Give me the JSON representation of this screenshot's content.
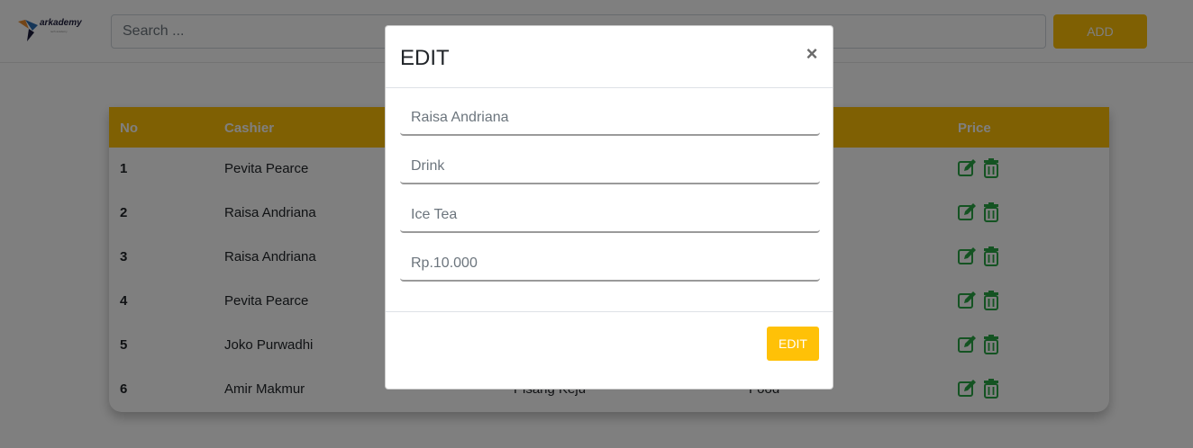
{
  "header": {
    "logo_text": "arkademy",
    "logo_subtext": "tech academy",
    "search_placeholder": "Search ...",
    "add_label": "ADD"
  },
  "table": {
    "headers": {
      "no": "No",
      "cashier": "Cashier",
      "price": "Price"
    },
    "rows": [
      {
        "no": "1",
        "cashier": "Pevita Pearce",
        "product": "",
        "category": ""
      },
      {
        "no": "2",
        "cashier": "Raisa Andriana",
        "product": "",
        "category": ""
      },
      {
        "no": "3",
        "cashier": "Raisa Andriana",
        "product": "",
        "category": ""
      },
      {
        "no": "4",
        "cashier": "Pevita Pearce",
        "product": "",
        "category": ""
      },
      {
        "no": "5",
        "cashier": "Joko Purwadhi",
        "product": "",
        "category": ""
      },
      {
        "no": "6",
        "cashier": "Amir Makmur",
        "product": "Pisang Keju",
        "category": "Food"
      }
    ]
  },
  "modal": {
    "title": "EDIT",
    "close_symbol": "×",
    "fields": {
      "cashier": "Raisa Andriana",
      "category": "Drink",
      "product": "Ice Tea",
      "price": "Rp.10.000"
    },
    "submit_label": "EDIT"
  },
  "colors": {
    "accent": "#ffc107",
    "icon_green": "#28a745",
    "overlay": "rgba(0,0,0,0.5)"
  },
  "icons": {
    "edit": "edit-icon",
    "delete": "trash-icon",
    "close": "close-icon"
  }
}
